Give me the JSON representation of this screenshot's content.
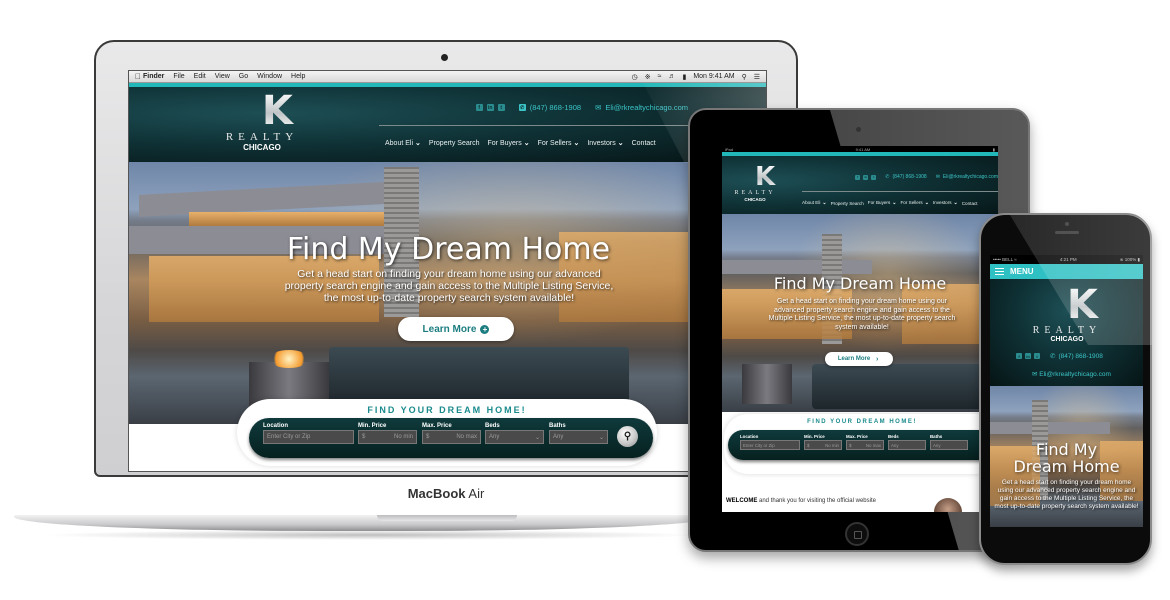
{
  "laptop": {
    "device_label_bold": "MacBook",
    "device_label_rest": " Air",
    "menubar": {
      "app": "Finder",
      "items": [
        "File",
        "Edit",
        "View",
        "Go",
        "Window",
        "Help"
      ],
      "clock": "Mon 9:41 AM"
    }
  },
  "site": {
    "brand": {
      "monogram_r": "R",
      "monogram_k": "K",
      "name": "REALTY",
      "city": "CHICAGO"
    },
    "contact": {
      "social": [
        "facebook",
        "linkedin",
        "twitter"
      ],
      "social_glyphs": [
        "f",
        "in",
        "t"
      ],
      "phone": "(847) 868-1908",
      "email": "Eli@rkrealtychicago.com"
    },
    "nav": [
      {
        "label": "About Eli",
        "dropdown": true
      },
      {
        "label": "Property Search",
        "dropdown": false
      },
      {
        "label": "For Buyers",
        "dropdown": true
      },
      {
        "label": "For Sellers",
        "dropdown": true
      },
      {
        "label": "Investors",
        "dropdown": true
      },
      {
        "label": "Contact",
        "dropdown": false
      }
    ],
    "hero": {
      "title": "Find My Dream Home",
      "title_line1": "Find My",
      "title_line2": "Dream Home",
      "subtitle": "Get a head start on finding your dream home using our advanced property search engine and gain access to the Multiple Listing Service, the most up-to-date property search system available!",
      "cta_label": "Learn More",
      "cta_icon_desktop": "+",
      "cta_icon_tablet": "›"
    },
    "search": {
      "title": "FIND YOUR DREAM HOME!",
      "fields": [
        {
          "label": "Location",
          "placeholder": "Enter City or Zip",
          "prefix": "",
          "type": "text"
        },
        {
          "label": "Min. Price",
          "placeholder": "No min",
          "prefix": "$",
          "type": "text"
        },
        {
          "label": "Max. Price",
          "placeholder": "No max",
          "prefix": "$",
          "type": "text"
        },
        {
          "label": "Beds",
          "placeholder": "Any",
          "prefix": "",
          "type": "select"
        },
        {
          "label": "Baths",
          "placeholder": "Any",
          "prefix": "",
          "type": "select"
        }
      ],
      "button_icon": "search"
    },
    "welcome": {
      "bold": "WELCOME",
      "rest": " and thank you for visiting the official website"
    },
    "colors": {
      "accent": "#22b7b8",
      "header_dark": "#0f3236",
      "cta_text": "#1c7d80",
      "search_title": "#1a8a8c"
    }
  },
  "tablet": {
    "status": {
      "device": "iPad",
      "time": "9:41 AM"
    }
  },
  "phone": {
    "status": {
      "carrier": "BELL",
      "time": "4:21 PM",
      "battery": "100%"
    },
    "menu_label": "MENU"
  }
}
